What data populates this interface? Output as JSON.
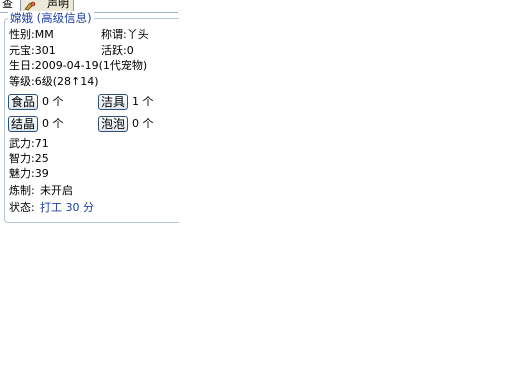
{
  "tabs": {
    "left_label": "查",
    "right_label": "声明"
  },
  "panel": {
    "title": "嫦娥 (高级信息)",
    "gender": "性别:MM",
    "title_field": "称谓:丫头",
    "yuanbao": "元宝:301",
    "active": "活跃:0",
    "birthday": "生日:2009-04-19(1代宠物)",
    "level": "等级:6级(28↑14)",
    "items": [
      {
        "button": "食品",
        "count": "0 个"
      },
      {
        "button": "洁具",
        "count": "1 个"
      },
      {
        "button": "结晶",
        "count": "0 个"
      },
      {
        "button": "泡泡",
        "count": "0 个"
      }
    ],
    "wuli": "武力:71",
    "zhili": "智力:25",
    "meili": "魅力:39",
    "refine_label": "炼制:",
    "refine_value": "未开启",
    "status_label": "状态:",
    "status_value": "打工 30 分"
  },
  "icons": {
    "tab_icon": "pet-tool-icon"
  },
  "colors": {
    "accent": "#1c3fa0",
    "border": "#b5c5d6"
  }
}
